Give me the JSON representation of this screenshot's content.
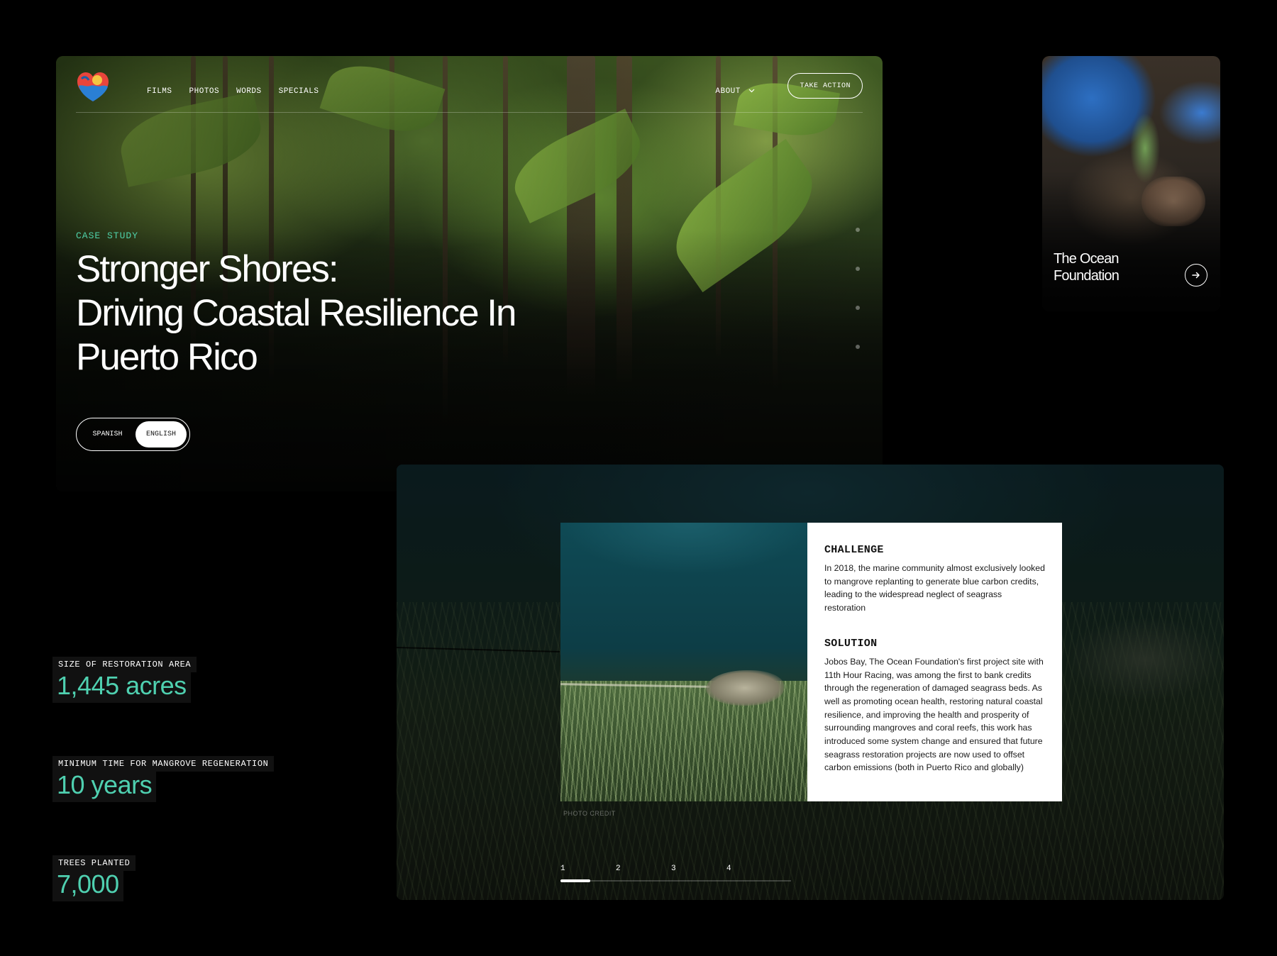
{
  "hero": {
    "nav": {
      "links": [
        "FILMS",
        "PHOTOS",
        "WORDS",
        "SPECIALS"
      ],
      "about_label": "ABOUT",
      "take_action_label": "TAKE ACTION"
    },
    "eyebrow": "CASE STUDY",
    "title_lines": [
      "Stronger Shores:",
      "Driving Coastal Resilience In",
      "Puerto Rico"
    ],
    "language_toggle": {
      "options": [
        "SPANISH",
        "ENGLISH"
      ],
      "selected": "ENGLISH"
    }
  },
  "org_card": {
    "title": "The Ocean Foundation",
    "icon": "arrow-right-icon"
  },
  "stats": [
    {
      "label": "SIZE OF RESTORATION AREA",
      "value": "1,445 acres"
    },
    {
      "label": "MINIMUM TIME FOR MANGROVE REGENERATION",
      "value": "10 years"
    },
    {
      "label": "TREES PLANTED",
      "value": "7,000"
    }
  ],
  "case_panel": {
    "challenge_heading": "CHALLENGE",
    "challenge_text": "In 2018, the marine community almost exclusively looked to mangrove replanting to generate blue carbon credits, leading to the widespread neglect of seagrass restoration",
    "solution_heading": "SOLUTION",
    "solution_text": "Jobos Bay, The Ocean Foundation's first project site with 11th Hour Racing, was among the first to bank credits through the regeneration of damaged seagrass beds. As well as promoting ocean health, restoring natural coastal resilience, and improving the health and prosperity of surrounding mangroves and coral reefs, this work has introduced some system change and ensured that future seagrass restoration projects are now used to offset carbon emissions (both in Puerto Rico and globally)",
    "photo_credit": "PHOTO CREDIT",
    "pager": {
      "pages": [
        "1",
        "2",
        "3",
        "4"
      ],
      "active_fraction": 0.13
    }
  },
  "colors": {
    "accent": "#4fd0b0",
    "background": "#000000"
  }
}
